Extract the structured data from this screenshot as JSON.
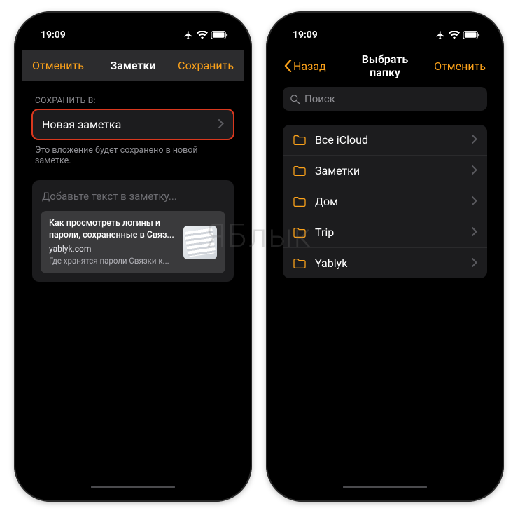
{
  "status": {
    "time": "19:09"
  },
  "left": {
    "nav": {
      "cancel": "Отменить",
      "title": "Заметки",
      "save": "Сохранить"
    },
    "section_label": "СОХРАНИТЬ В:",
    "save_target": "Новая заметка",
    "hint": "Это вложение будет сохранено в новой заметке.",
    "compose_placeholder": "Добавьте текст в заметку...",
    "link": {
      "title": "Как просмотреть логины и пароли, сохраненные в Связ...",
      "domain": "yablyk.com",
      "desc": "Где хранятся пароли Связки к..."
    }
  },
  "right": {
    "nav": {
      "back": "Назад",
      "title": "Выбрать папку",
      "cancel": "Отменить"
    },
    "search_placeholder": "Поиск",
    "folders": [
      {
        "label": "Все iCloud"
      },
      {
        "label": "Заметки"
      },
      {
        "label": "Дом"
      },
      {
        "label": "Trip"
      },
      {
        "label": "Yablyk"
      }
    ]
  },
  "watermark": "ЯБлык"
}
